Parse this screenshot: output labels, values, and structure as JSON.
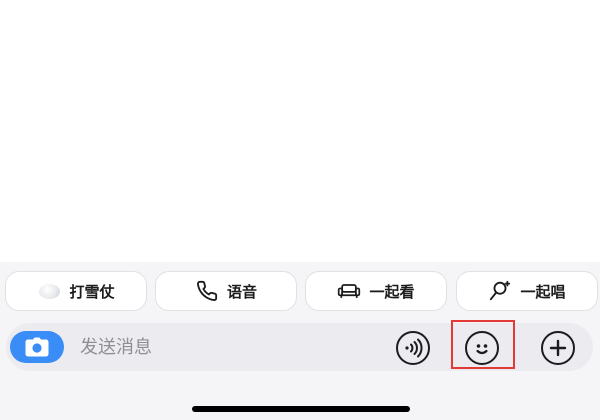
{
  "quick_actions": [
    {
      "label": "打雪仗",
      "icon": "snowball-icon"
    },
    {
      "label": "语音",
      "icon": "phone-icon"
    },
    {
      "label": "一起看",
      "icon": "sofa-icon"
    },
    {
      "label": "一起唱",
      "icon": "microphone-icon"
    }
  ],
  "input_bar": {
    "placeholder": "发送消息",
    "camera_icon": "camera-icon",
    "voice_icon": "voice-wave-icon",
    "emoji_icon": "smiley-face-icon",
    "plus_icon": "plus-icon"
  },
  "colors": {
    "accent": "#3a8df7",
    "highlight": "#e53935",
    "panel_background": "#f5f5f7",
    "input_background": "#ebebf0"
  }
}
